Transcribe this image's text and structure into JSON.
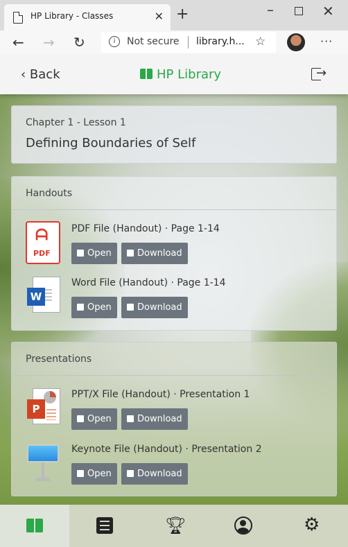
{
  "browser": {
    "tab_title": "HP Library - Classes",
    "tab_close": "✕",
    "new_tab": "+",
    "address": {
      "security_label": "Not secure",
      "url": "library.h..."
    }
  },
  "header": {
    "back_label": "Back",
    "brand": "HP Library"
  },
  "lesson": {
    "subtitle": "Chapter 1 - Lesson 1",
    "title": "Defining Boundaries of Self"
  },
  "handouts": {
    "heading": "Handouts",
    "files": [
      {
        "label": "PDF File (Handout) · Page 1-14",
        "icon": "pdf-file-icon",
        "icon_text": "PDF",
        "open": "Open",
        "download": "Download"
      },
      {
        "label": "Word File (Handout) · Page 1-14",
        "icon": "word-file-icon",
        "icon_text": "W",
        "open": "Open",
        "download": "Download"
      }
    ]
  },
  "presentations": {
    "heading": "Presentations",
    "files": [
      {
        "label": "PPT/X File (Handout) · Presentation 1",
        "icon": "ppt-file-icon",
        "icon_text": "P",
        "open": "Open",
        "download": "Download"
      },
      {
        "label": "Keynote File (Handout) · Presentation 2",
        "icon": "keynote-file-icon",
        "open": "Open",
        "download": "Download"
      }
    ]
  },
  "bottom_nav": {
    "items": [
      "library-icon",
      "list-icon",
      "trophy-icon",
      "profile-icon",
      "settings-icon"
    ],
    "active": "library-icon"
  },
  "colors": {
    "brand_green": "#2aa84a",
    "button_gray": "#6c757d",
    "pdf_red": "#e2382c",
    "word_blue": "#1f5fb5",
    "ppt_orange": "#d04423"
  }
}
